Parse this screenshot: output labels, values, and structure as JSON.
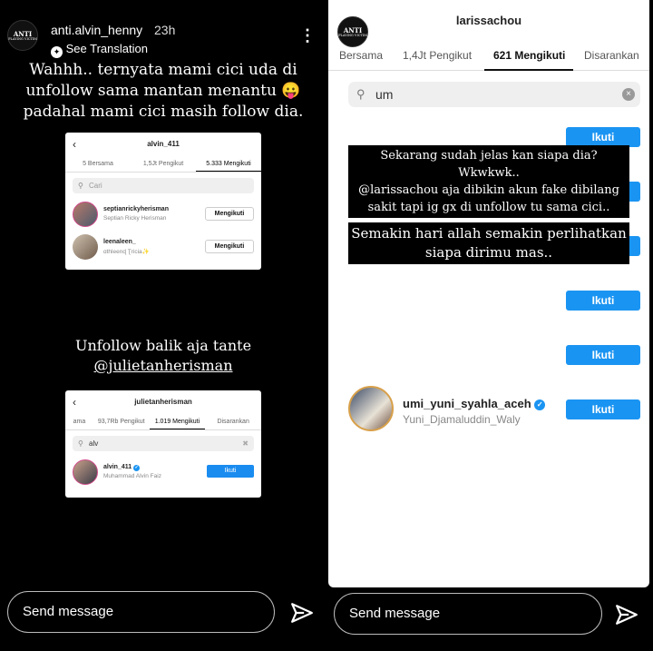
{
  "left": {
    "username": "anti.alvin_henny",
    "time": "23h",
    "avatar_text": "ANTI",
    "avatar_subtext": "PLAYING VICTIM",
    "see_translation": "See Translation",
    "caption1": [
      "Wahhh.. ternyata mami cici uda di",
      "unfollow sama mantan menantu 😛",
      "padahal mami cici masih follow dia."
    ],
    "card1": {
      "title": "alvin_411",
      "tabs": [
        "5 Bersama",
        "1,5Jt Pengikut",
        "5.333 Mengikuti"
      ],
      "search_placeholder": "Cari",
      "rows": [
        {
          "name": "septianrickyherisman",
          "sub": "Septian Ricky Herisman",
          "button": "Mengikuti"
        },
        {
          "name": "leenaleen_",
          "sub": "ɑthleenɖ Ʈricia✨",
          "button": "Mengikuti"
        }
      ]
    },
    "caption2": [
      "Unfollow balik aja tante",
      "@julietanherisman"
    ],
    "card2": {
      "title": "julietanherisman",
      "tabs": [
        "ama",
        "93,7Rb Pengikut",
        "1.019 Mengikuti",
        "Disarankan"
      ],
      "search_value": "alv",
      "row": {
        "name": "alvin_411",
        "sub": "Muhammad Alvin Faiz",
        "button": "Ikuti"
      }
    },
    "send_placeholder": "Send message"
  },
  "right": {
    "username": "anti.alvin_henny",
    "time": "23h",
    "see_translation": "See Translation",
    "title": "larissachou",
    "tabs": [
      "Bersama",
      "1,4Jt Pengikut",
      "621 Mengikuti",
      "Disarankan"
    ],
    "search_value": "um",
    "ikuti_label": "Ikuti",
    "text1": [
      "Sekarang sudah jelas kan siapa dia? Wkwkwk..",
      "@larissachou aja dibikin akun fake dibilang",
      "sakit tapi ig gx di unfollow tu sama cici.."
    ],
    "text2": [
      "Semakin hari allah semakin perlihatkan",
      "siapa dirimu mas.."
    ],
    "user_row": {
      "name": "umi_yuni_syahla_aceh",
      "sub": "Yuni_Djamaluddin_Waly"
    },
    "send_placeholder": "Send message"
  },
  "colors": {
    "blue": "#1a94f2",
    "verified": "#1a94f2"
  }
}
